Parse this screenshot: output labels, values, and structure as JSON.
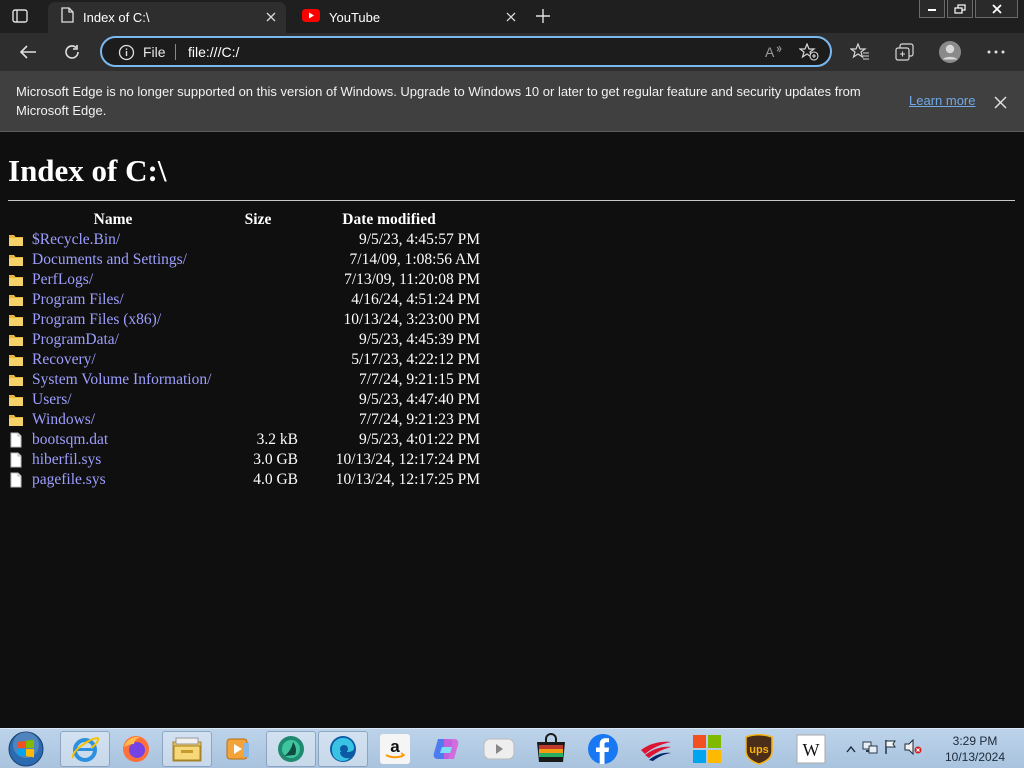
{
  "tabs": [
    {
      "label": "Index of C:\\",
      "active": true,
      "icon": "page-icon"
    },
    {
      "label": "YouTube",
      "active": false,
      "icon": "youtube-icon"
    }
  ],
  "address": {
    "info_label": "File",
    "url": "file:///C:/"
  },
  "infobar": {
    "message": "Microsoft Edge is no longer supported on this version of Windows. Upgrade to Windows 10 or later to get regular feature and security updates from Microsoft Edge.",
    "learn_more": "Learn more"
  },
  "page": {
    "title": "Index of C:\\",
    "columns": {
      "name": "Name",
      "size": "Size",
      "date": "Date modified"
    },
    "rows": [
      {
        "name": "$Recycle.Bin/",
        "size": "",
        "date": "9/5/23, 4:45:57 PM",
        "type": "folder"
      },
      {
        "name": "Documents and Settings/",
        "size": "",
        "date": "7/14/09, 1:08:56 AM",
        "type": "folder"
      },
      {
        "name": "PerfLogs/",
        "size": "",
        "date": "7/13/09, 11:20:08 PM",
        "type": "folder"
      },
      {
        "name": "Program Files/",
        "size": "",
        "date": "4/16/24, 4:51:24 PM",
        "type": "folder"
      },
      {
        "name": "Program Files (x86)/",
        "size": "",
        "date": "10/13/24, 3:23:00 PM",
        "type": "folder"
      },
      {
        "name": "ProgramData/",
        "size": "",
        "date": "9/5/23, 4:45:39 PM",
        "type": "folder"
      },
      {
        "name": "Recovery/",
        "size": "",
        "date": "5/17/23, 4:22:12 PM",
        "type": "folder"
      },
      {
        "name": "System Volume Information/",
        "size": "",
        "date": "7/7/24, 9:21:15 PM",
        "type": "folder"
      },
      {
        "name": "Users/",
        "size": "",
        "date": "9/5/23, 4:47:40 PM",
        "type": "folder"
      },
      {
        "name": "Windows/",
        "size": "",
        "date": "7/7/24, 9:21:23 PM",
        "type": "folder"
      },
      {
        "name": "bootsqm.dat",
        "size": "3.2 kB",
        "date": "9/5/23, 4:01:22 PM",
        "type": "file"
      },
      {
        "name": "hiberfil.sys",
        "size": "3.0 GB",
        "date": "10/13/24, 12:17:24 PM",
        "type": "file"
      },
      {
        "name": "pagefile.sys",
        "size": "4.0 GB",
        "date": "10/13/24, 12:17:25 PM",
        "type": "file"
      }
    ]
  },
  "taskbar": {
    "apps": [
      "internet-explorer-icon",
      "firefox-icon",
      "file-explorer-icon",
      "media-player-icon",
      "app-icon",
      "edge-icon",
      "amazon-icon",
      "copilot-icon",
      "youtube-app-icon",
      "store-icon",
      "facebook-icon",
      "bank-icon",
      "microsoft-icon",
      "ups-icon",
      "wikipedia-icon"
    ],
    "wikipedia_letter": "W",
    "ups_text": "ups",
    "time": "3:29 PM",
    "date": "10/13/2024"
  },
  "colors": {
    "link": "#9e9eff",
    "background": "#0f0f0f",
    "focus_ring": "#7bb8f0",
    "learn_more": "#70a8e8"
  }
}
